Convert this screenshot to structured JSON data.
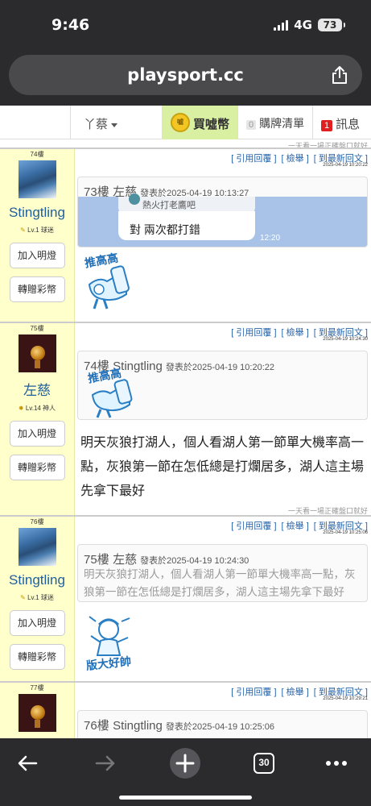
{
  "status": {
    "time": "9:46",
    "network": "4G",
    "battery": "73"
  },
  "browser": {
    "url": "playsport.cc",
    "tab_count": "30"
  },
  "nav": {
    "user": "丫蔡",
    "buy": "買噓幣",
    "cart_count": "0",
    "cart": "購牌清單",
    "msg_count": "1",
    "msg": "訊息"
  },
  "signature": "一天看一場正確盤口就好",
  "actions": {
    "quote": "[ 引用回覆 ]",
    "report": "[ 檢舉 ]",
    "latest": "[ 到最新回文 ]"
  },
  "buttons": {
    "light": "加入明燈",
    "gift": "轉贈彩幣"
  },
  "posts": [
    {
      "floor": "74樓",
      "user": "Stingtling",
      "level": "Lv.1 球迷",
      "time": "2025-04-19 10:20:22",
      "quote_num": "73樓",
      "quote_user": "左慈",
      "quote_date": "發表於2025-04-19 10:13:27",
      "chat_top": "熱火打老鷹吧",
      "chat_reply": "對 兩次都打錯",
      "chat_time": "12:20",
      "sticker_text": "推高高"
    },
    {
      "floor": "75樓",
      "user": "左慈",
      "level": "Lv.14 神人",
      "time": "2025-04-19 10:24:30",
      "quote_num": "74樓",
      "quote_user": "Stingtling",
      "quote_date": "發表於2025-04-19 10:20:22",
      "sticker_text": "推高高",
      "body": "明天灰狼打湖人，個人看湖人第一節單大機率高一點，灰狼第一節在怎低總是打爛居多，湖人這主場先拿下最好"
    },
    {
      "floor": "76樓",
      "user": "Stingtling",
      "level": "Lv.1 球迷",
      "time": "2025-04-19 10:25:06",
      "quote_num": "75樓",
      "quote_user": "左慈",
      "quote_date": "發表於2025-04-19 10:24:30",
      "quote_body": "明天灰狼打湖人，個人看湖人第一節單大機率高一點，灰狼第一節在怎低總是打爛居多，湖人這主場先拿下最好",
      "sticker_text": "版大好帥"
    },
    {
      "floor": "77樓",
      "time": "2025-04-19 10:29:21",
      "quote_num": "76樓",
      "quote_user": "Stingtling",
      "quote_date": "發表於2025-04-19 10:25:06"
    }
  ]
}
